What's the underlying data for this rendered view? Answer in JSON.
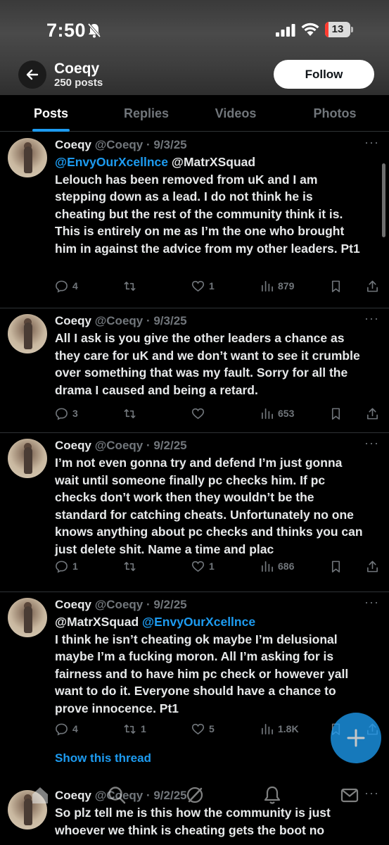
{
  "status_bar": {
    "time": "7:50",
    "battery_level": "13",
    "icons": [
      "bell-slash-icon",
      "cellular-signal-icon",
      "wifi-icon",
      "battery-icon"
    ]
  },
  "header": {
    "profile_name": "Coeqy",
    "posts_count": "250 posts",
    "follow_label": "Follow"
  },
  "tabs": [
    {
      "label": "Posts",
      "active": true
    },
    {
      "label": "Replies",
      "active": false
    },
    {
      "label": "Videos",
      "active": false
    },
    {
      "label": "Photos",
      "active": false
    }
  ],
  "tweets": [
    {
      "name": "Coeqy",
      "handle_date": "@Coeqy · 9/3/25",
      "mentions": [
        "@EnvyOurXcellnce",
        "@MatrXSquad"
      ],
      "text": "Lelouch has been removed from uK and I am stepping down as a lead. I do not think he is cheating but the rest of the community think it is. This is entirely on me as I’m the one who brought him in against the advice from my other leaders. Pt1",
      "replies": "4",
      "reposts": "",
      "likes": "1",
      "views": "879"
    },
    {
      "name": "Coeqy",
      "handle_date": "@Coeqy · 9/3/25",
      "text": "All I ask is you give the other leaders a chance as they care for uK and we don’t want to see it crumble over something that was my fault. Sorry for all the drama I caused and being a retard.",
      "replies": "3",
      "reposts": "",
      "likes": "",
      "views": "653"
    },
    {
      "name": "Coeqy",
      "handle_date": "@Coeqy · 9/2/25",
      "text": "I’m not even gonna try and defend I’m just gonna wait until someone finally pc checks him. If pc checks don’t work then they wouldn’t be the standard for catching cheats. Unfortunately no one knows anything about pc checks and thinks you can just delete shit. Name a time and plac",
      "replies": "1",
      "reposts": "",
      "likes": "1",
      "views": "686"
    },
    {
      "name": "Coeqy",
      "handle_date": "@Coeqy · 9/2/25",
      "mentions": [
        "@MatrXSquad",
        "@EnvyOurXcellnce"
      ],
      "text": "I think he isn’t cheating ok maybe I’m delusional maybe I’m a fucking moron. All I’m asking for is fairness and to have him pc check or however yall want to do it. Everyone should have a chance to prove innocence. Pt1",
      "replies": "4",
      "reposts": "1",
      "likes": "5",
      "views": "1.8K",
      "show_thread": "Show this thread"
    },
    {
      "name": "Coeqy",
      "handle_date": "@Coeqy · 9/2/25",
      "line1": "So plz tell me is this how the community is just",
      "line2": "whoever we think is cheating gets the boot no"
    }
  ],
  "accent_color": "#1d9bf0",
  "more_glyph": "···"
}
